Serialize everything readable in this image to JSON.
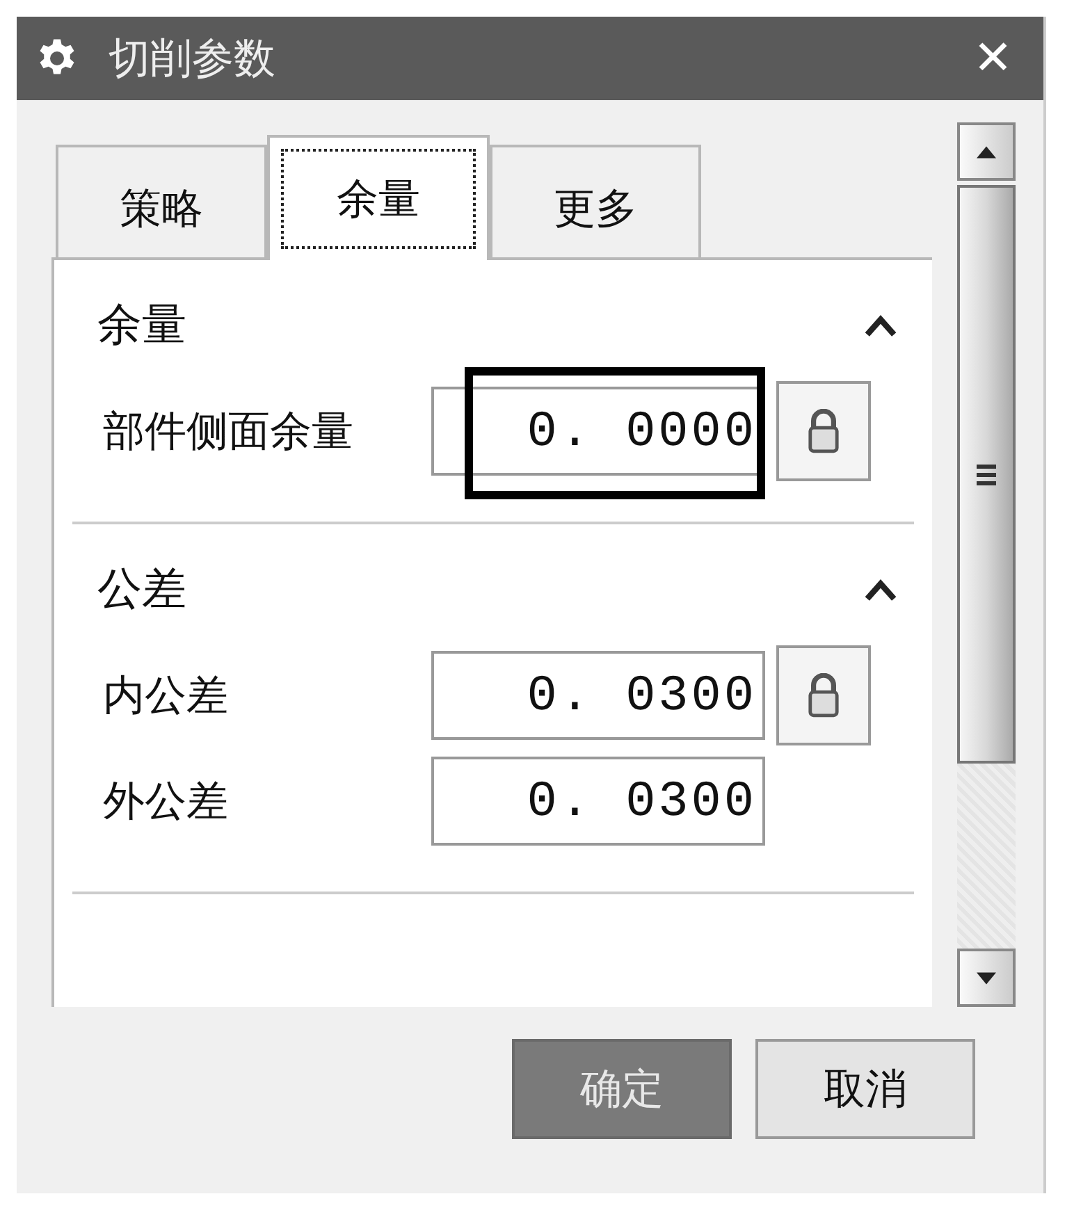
{
  "window": {
    "title": "切削参数",
    "close": "✕"
  },
  "tabs": [
    {
      "label": "策略",
      "selected": false
    },
    {
      "label": "余量",
      "selected": true
    },
    {
      "label": "更多",
      "selected": false
    }
  ],
  "sections": [
    {
      "title": "余量",
      "expanded": true,
      "rows": [
        {
          "label": "部件侧面余量",
          "value": "0. 0000",
          "kind": "locked",
          "highlighted": true
        }
      ]
    },
    {
      "title": "公差",
      "expanded": true,
      "rows": [
        {
          "label": "内公差",
          "value": "0. 0300",
          "kind": "locked",
          "highlighted": false
        },
        {
          "label": "外公差",
          "value": "0. 0300",
          "kind": "plain",
          "highlighted": false
        }
      ]
    }
  ],
  "buttons": [
    {
      "label": "确定",
      "kind": "primary"
    },
    {
      "label": "取消",
      "kind": "default"
    }
  ]
}
